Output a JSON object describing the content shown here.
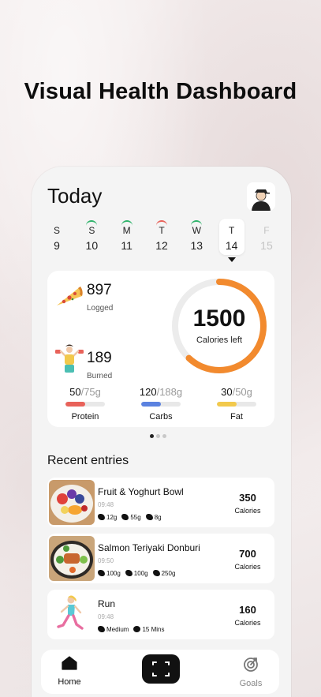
{
  "hero": {
    "title": "Visual Health Dashboard"
  },
  "header": {
    "title": "Today"
  },
  "days": [
    {
      "name": "S",
      "num": "9",
      "state": "normal",
      "arc": ""
    },
    {
      "name": "S",
      "num": "10",
      "state": "normal",
      "arc": "#2fb36b"
    },
    {
      "name": "M",
      "num": "11",
      "state": "normal",
      "arc": "#2fb36b"
    },
    {
      "name": "T",
      "num": "12",
      "state": "normal",
      "arc": "#e8625a"
    },
    {
      "name": "W",
      "num": "13",
      "state": "normal",
      "arc": "#2fb36b"
    },
    {
      "name": "T",
      "num": "14",
      "state": "active",
      "arc": ""
    },
    {
      "name": "F",
      "num": "15",
      "state": "future",
      "arc": ""
    }
  ],
  "summary": {
    "logged": {
      "value": "897",
      "label": "Logged"
    },
    "burned": {
      "value": "189",
      "label": "Burned"
    },
    "remaining": {
      "value": "1500",
      "label": "Calories left"
    },
    "ring_progress": 0.62,
    "ring_color": "#f28a2e"
  },
  "macros": [
    {
      "eaten": "50",
      "total": "/75g",
      "name": "Protein",
      "progress": 0.5,
      "color": "#e8625a"
    },
    {
      "eaten": "120",
      "total": "/188g",
      "name": "Carbs",
      "progress": 0.5,
      "color": "#5b82e0"
    },
    {
      "eaten": "30",
      "total": "/50g",
      "name": "Fat",
      "progress": 0.5,
      "color": "#f2c94c"
    }
  ],
  "recent": {
    "title": "Recent entries",
    "entries": [
      {
        "title": "Fruit & Yoghurt Bowl",
        "time": "09:48",
        "tags": [
          "12g",
          "55g",
          "8g"
        ],
        "cal": "350",
        "unit": "Calories"
      },
      {
        "title": "Salmon Teriyaki Donburi",
        "time": "09:50",
        "tags": [
          "100g",
          "100g",
          "250g"
        ],
        "cal": "700",
        "unit": "Calories"
      },
      {
        "title": "Run",
        "time": "09:48",
        "tags": [
          "Medium",
          "15 Mins"
        ],
        "cal": "160",
        "unit": "Calories"
      }
    ]
  },
  "nav": {
    "home": "Home",
    "goals": "Goals"
  }
}
